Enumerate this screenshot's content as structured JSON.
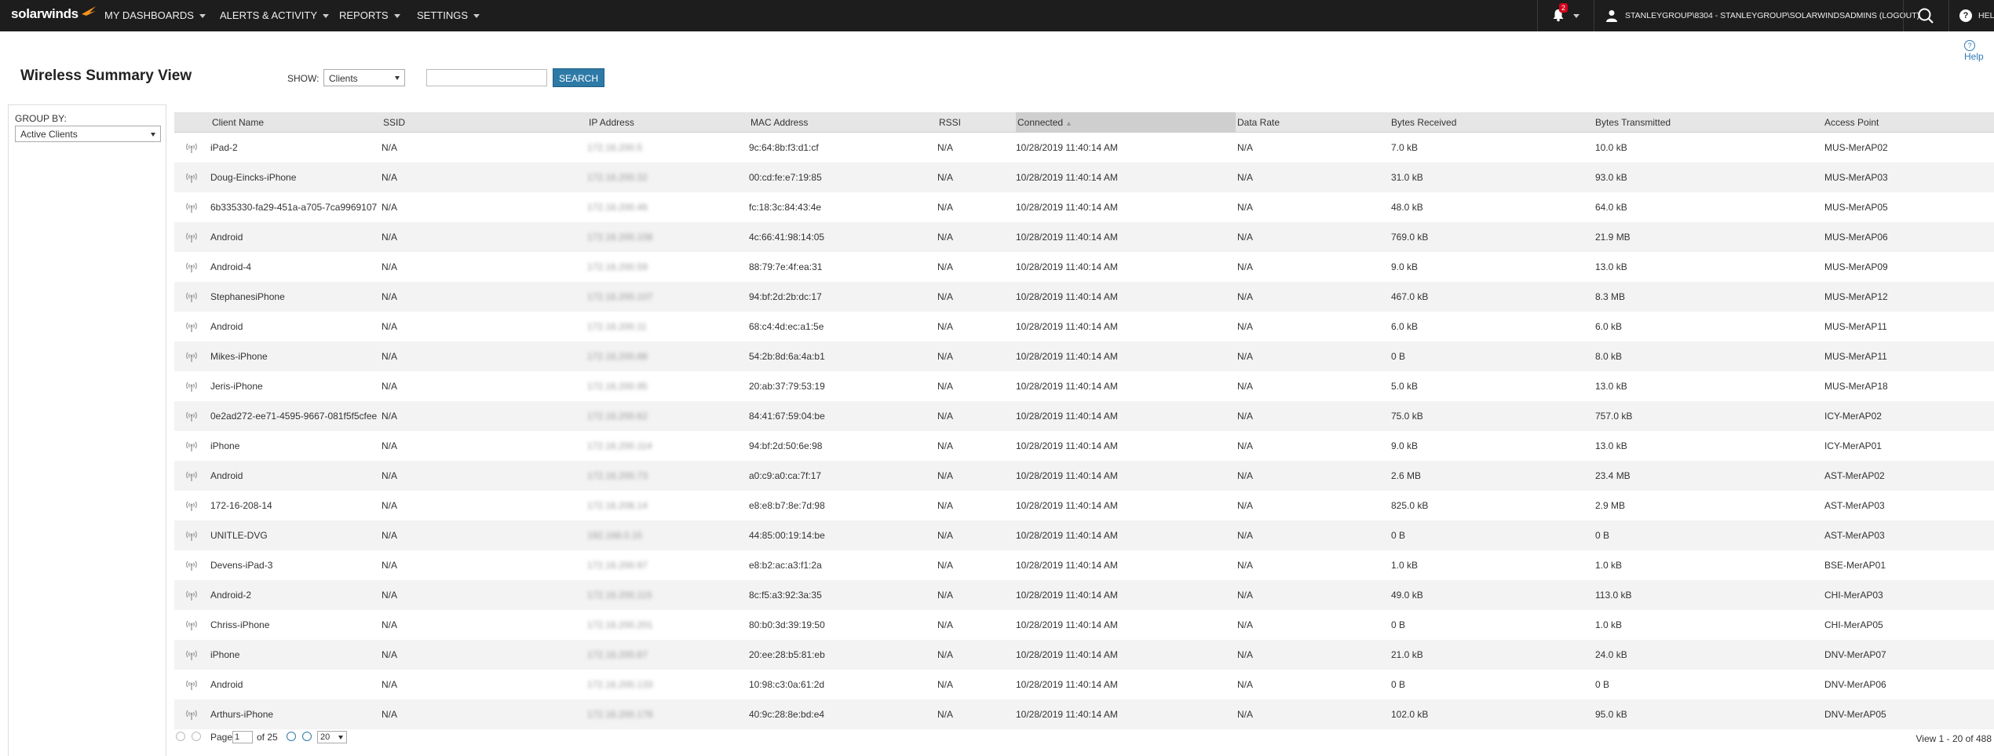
{
  "app": {
    "logo": "solarwinds",
    "nav": [
      {
        "label": "MY DASHBOARDS"
      },
      {
        "label": "ALERTS & ACTIVITY"
      },
      {
        "label": "REPORTS"
      },
      {
        "label": "SETTINGS"
      }
    ],
    "notification_count": "2",
    "user_text": "STANLEYGROUP\\8304 - STANLEYGROUP\\SOLARWINDSADMINS (LOGOUT)",
    "help_text": "HEL"
  },
  "header": {
    "help_link": "Help",
    "title": "Wireless Summary View",
    "show_label": "SHOW:",
    "show_value": "Clients",
    "search_value": "",
    "search_button": "SEARCH"
  },
  "sidebar": {
    "group_by_label": "GROUP BY:",
    "group_by_value": "Active Clients"
  },
  "table": {
    "columns": [
      "Client Name",
      "SSID",
      "IP Address",
      "MAC Address",
      "RSSI",
      "Connected",
      "Data Rate",
      "Bytes Received",
      "Bytes Transmitted",
      "Access Point"
    ],
    "sorted_column": "Connected",
    "rows": [
      {
        "name": "iPad-2",
        "ssid": "N/A",
        "ip": "172.16.200.5",
        "mac": "9c:64:8b:f3:d1:cf",
        "rssi": "N/A",
        "connected": "10/28/2019 11:40:14 AM",
        "rate": "N/A",
        "rx": "7.0 kB",
        "tx": "10.0 kB",
        "ap": "MUS-MerAP02"
      },
      {
        "name": "Doug-Eincks-iPhone",
        "ssid": "N/A",
        "ip": "172.16.200.32",
        "mac": "00:cd:fe:e7:19:85",
        "rssi": "N/A",
        "connected": "10/28/2019 11:40:14 AM",
        "rate": "N/A",
        "rx": "31.0 kB",
        "tx": "93.0 kB",
        "ap": "MUS-MerAP03"
      },
      {
        "name": "6b335330-fa29-451a-a705-7ca9969107",
        "ssid": "N/A",
        "ip": "172.16.200.46",
        "mac": "fc:18:3c:84:43:4e",
        "rssi": "N/A",
        "connected": "10/28/2019 11:40:14 AM",
        "rate": "N/A",
        "rx": "48.0 kB",
        "tx": "64.0 kB",
        "ap": "MUS-MerAP05"
      },
      {
        "name": "Android",
        "ssid": "N/A",
        "ip": "172.16.200.108",
        "mac": "4c:66:41:98:14:05",
        "rssi": "N/A",
        "connected": "10/28/2019 11:40:14 AM",
        "rate": "N/A",
        "rx": "769.0 kB",
        "tx": "21.9 MB",
        "ap": "MUS-MerAP06"
      },
      {
        "name": "Android-4",
        "ssid": "N/A",
        "ip": "172.16.200.59",
        "mac": "88:79:7e:4f:ea:31",
        "rssi": "N/A",
        "connected": "10/28/2019 11:40:14 AM",
        "rate": "N/A",
        "rx": "9.0 kB",
        "tx": "13.0 kB",
        "ap": "MUS-MerAP09"
      },
      {
        "name": "StephanesiPhone",
        "ssid": "N/A",
        "ip": "172.16.200.107",
        "mac": "94:bf:2d:2b:dc:17",
        "rssi": "N/A",
        "connected": "10/28/2019 11:40:14 AM",
        "rate": "N/A",
        "rx": "467.0 kB",
        "tx": "8.3 MB",
        "ap": "MUS-MerAP12"
      },
      {
        "name": "Android",
        "ssid": "N/A",
        "ip": "172.16.200.11",
        "mac": "68:c4:4d:ec:a1:5e",
        "rssi": "N/A",
        "connected": "10/28/2019 11:40:14 AM",
        "rate": "N/A",
        "rx": "6.0 kB",
        "tx": "6.0 kB",
        "ap": "MUS-MerAP11"
      },
      {
        "name": "Mikes-iPhone",
        "ssid": "N/A",
        "ip": "172.16.200.88",
        "mac": "54:2b:8d:6a:4a:b1",
        "rssi": "N/A",
        "connected": "10/28/2019 11:40:14 AM",
        "rate": "N/A",
        "rx": "0 B",
        "tx": "8.0 kB",
        "ap": "MUS-MerAP11"
      },
      {
        "name": "Jeris-iPhone",
        "ssid": "N/A",
        "ip": "172.16.200.95",
        "mac": "20:ab:37:79:53:19",
        "rssi": "N/A",
        "connected": "10/28/2019 11:40:14 AM",
        "rate": "N/A",
        "rx": "5.0 kB",
        "tx": "13.0 kB",
        "ap": "MUS-MerAP18"
      },
      {
        "name": "0e2ad272-ee71-4595-9667-081f5f5cfee",
        "ssid": "N/A",
        "ip": "172.16.200.62",
        "mac": "84:41:67:59:04:be",
        "rssi": "N/A",
        "connected": "10/28/2019 11:40:14 AM",
        "rate": "N/A",
        "rx": "75.0 kB",
        "tx": "757.0 kB",
        "ap": "ICY-MerAP02"
      },
      {
        "name": "iPhone",
        "ssid": "N/A",
        "ip": "172.16.200.114",
        "mac": "94:bf:2d:50:6e:98",
        "rssi": "N/A",
        "connected": "10/28/2019 11:40:14 AM",
        "rate": "N/A",
        "rx": "9.0 kB",
        "tx": "13.0 kB",
        "ap": "ICY-MerAP01"
      },
      {
        "name": "Android",
        "ssid": "N/A",
        "ip": "172.16.200.73",
        "mac": "a0:c9:a0:ca:7f:17",
        "rssi": "N/A",
        "connected": "10/28/2019 11:40:14 AM",
        "rate": "N/A",
        "rx": "2.6 MB",
        "tx": "23.4 MB",
        "ap": "AST-MerAP02"
      },
      {
        "name": "172-16-208-14",
        "ssid": "N/A",
        "ip": "172.16.208.14",
        "mac": "e8:e8:b7:8e:7d:98",
        "rssi": "N/A",
        "connected": "10/28/2019 11:40:14 AM",
        "rate": "N/A",
        "rx": "825.0 kB",
        "tx": "2.9 MB",
        "ap": "AST-MerAP03"
      },
      {
        "name": "UNITLE-DVG",
        "ssid": "N/A",
        "ip": "192.168.0.15",
        "mac": "44:85:00:19:14:be",
        "rssi": "N/A",
        "connected": "10/28/2019 11:40:14 AM",
        "rate": "N/A",
        "rx": "0 B",
        "tx": "0 B",
        "ap": "AST-MerAP03"
      },
      {
        "name": "Devens-iPad-3",
        "ssid": "N/A",
        "ip": "172.16.200.97",
        "mac": "e8:b2:ac:a3:f1:2a",
        "rssi": "N/A",
        "connected": "10/28/2019 11:40:14 AM",
        "rate": "N/A",
        "rx": "1.0 kB",
        "tx": "1.0 kB",
        "ap": "BSE-MerAP01"
      },
      {
        "name": "Android-2",
        "ssid": "N/A",
        "ip": "172.16.200.115",
        "mac": "8c:f5:a3:92:3a:35",
        "rssi": "N/A",
        "connected": "10/28/2019 11:40:14 AM",
        "rate": "N/A",
        "rx": "49.0 kB",
        "tx": "113.0 kB",
        "ap": "CHI-MerAP03"
      },
      {
        "name": "Chriss-iPhone",
        "ssid": "N/A",
        "ip": "172.16.200.201",
        "mac": "80:b0:3d:39:19:50",
        "rssi": "N/A",
        "connected": "10/28/2019 11:40:14 AM",
        "rate": "N/A",
        "rx": "0 B",
        "tx": "1.0 kB",
        "ap": "CHI-MerAP05"
      },
      {
        "name": "iPhone",
        "ssid": "N/A",
        "ip": "172.16.200.87",
        "mac": "20:ee:28:b5:81:eb",
        "rssi": "N/A",
        "connected": "10/28/2019 11:40:14 AM",
        "rate": "N/A",
        "rx": "21.0 kB",
        "tx": "24.0 kB",
        "ap": "DNV-MerAP07"
      },
      {
        "name": "Android",
        "ssid": "N/A",
        "ip": "172.16.200.133",
        "mac": "10:98:c3:0a:61:2d",
        "rssi": "N/A",
        "connected": "10/28/2019 11:40:14 AM",
        "rate": "N/A",
        "rx": "0 B",
        "tx": "0 B",
        "ap": "DNV-MerAP06"
      },
      {
        "name": "Arthurs-iPhone",
        "ssid": "N/A",
        "ip": "172.16.200.178",
        "mac": "40:9c:28:8e:bd:e4",
        "rssi": "N/A",
        "connected": "10/28/2019 11:40:14 AM",
        "rate": "N/A",
        "rx": "102.0 kB",
        "tx": "95.0 kB",
        "ap": "DNV-MerAP05"
      }
    ]
  },
  "pager": {
    "page_label": "Page",
    "page_value": "1",
    "of_text": "of 25",
    "page_size": "20",
    "view_count": "View 1 - 20 of 488"
  },
  "colors": {
    "topbar": "#1d1d1d",
    "accent": "#2e7aa7",
    "brand_orange": "#f7931e",
    "badge": "#d0021b"
  },
  "icons": {
    "row_icon": "wireless-client-icon",
    "bell": "bell-icon",
    "user": "user-icon",
    "search": "search-icon",
    "help": "help-icon"
  }
}
